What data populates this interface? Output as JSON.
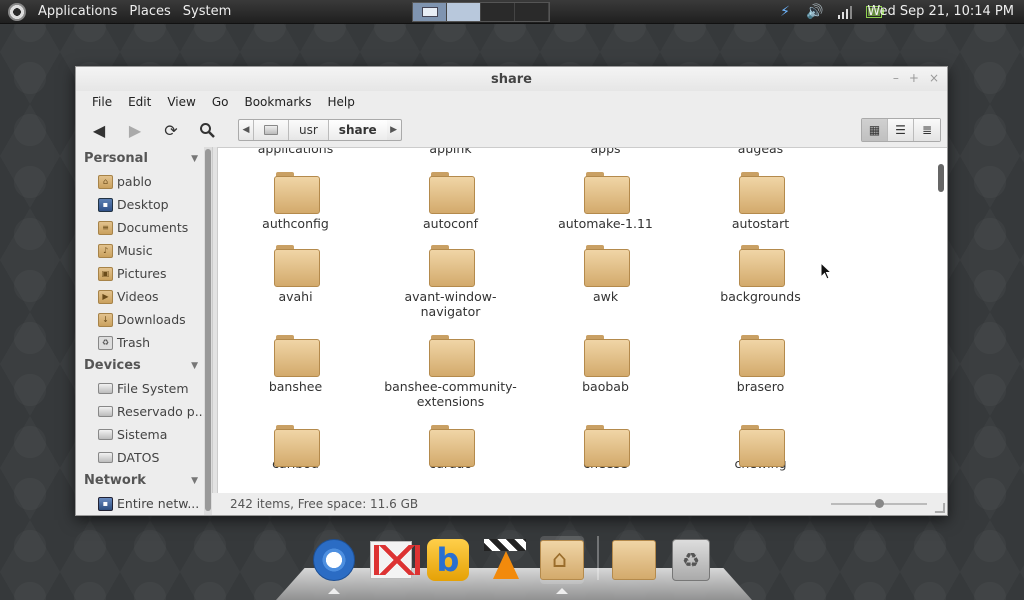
{
  "top_panel": {
    "menu": [
      "Applications",
      "Places",
      "System"
    ],
    "clock": "Wed Sep 21, 10:14 PM",
    "tray_icons": [
      "bolt-icon",
      "volume-icon",
      "network-icon",
      "battery-icon"
    ]
  },
  "window": {
    "title": "share",
    "menubar": [
      "File",
      "Edit",
      "View",
      "Go",
      "Bookmarks",
      "Help"
    ],
    "path": [
      "usr",
      "share"
    ],
    "status": "242 items, Free space: 11.6 GB"
  },
  "sidebar": {
    "sections": [
      {
        "title": "Personal",
        "items": [
          {
            "label": "pablo",
            "icon": "home-folder-icon"
          },
          {
            "label": "Desktop",
            "icon": "desktop-icon"
          },
          {
            "label": "Documents",
            "icon": "documents-folder-icon"
          },
          {
            "label": "Music",
            "icon": "music-folder-icon"
          },
          {
            "label": "Pictures",
            "icon": "pictures-folder-icon"
          },
          {
            "label": "Videos",
            "icon": "videos-folder-icon"
          },
          {
            "label": "Downloads",
            "icon": "downloads-folder-icon"
          },
          {
            "label": "Trash",
            "icon": "trash-icon"
          }
        ]
      },
      {
        "title": "Devices",
        "items": [
          {
            "label": "File System",
            "icon": "drive-icon"
          },
          {
            "label": "Reservado p...",
            "icon": "drive-icon"
          },
          {
            "label": "Sistema",
            "icon": "drive-icon"
          },
          {
            "label": "DATOS",
            "icon": "drive-icon"
          }
        ]
      },
      {
        "title": "Network",
        "items": [
          {
            "label": "Entire netw...",
            "icon": "network-icon"
          }
        ]
      }
    ]
  },
  "folders": [
    [
      "applications",
      "applnk",
      "apps",
      "augeas"
    ],
    [
      "authconfig",
      "autoconf",
      "automake-1.11",
      "autostart"
    ],
    [
      "avahi",
      "avant-window-navigator",
      "awk",
      "backgrounds"
    ],
    [
      "banshee",
      "banshee-community-extensions",
      "baobab",
      "brasero"
    ],
    [
      "caribou",
      "cdrdao",
      "cheese",
      "chewing"
    ]
  ],
  "dock": [
    "chromium",
    "gmail",
    "bmail",
    "vlc",
    "home-folder",
    "folder",
    "trash"
  ]
}
